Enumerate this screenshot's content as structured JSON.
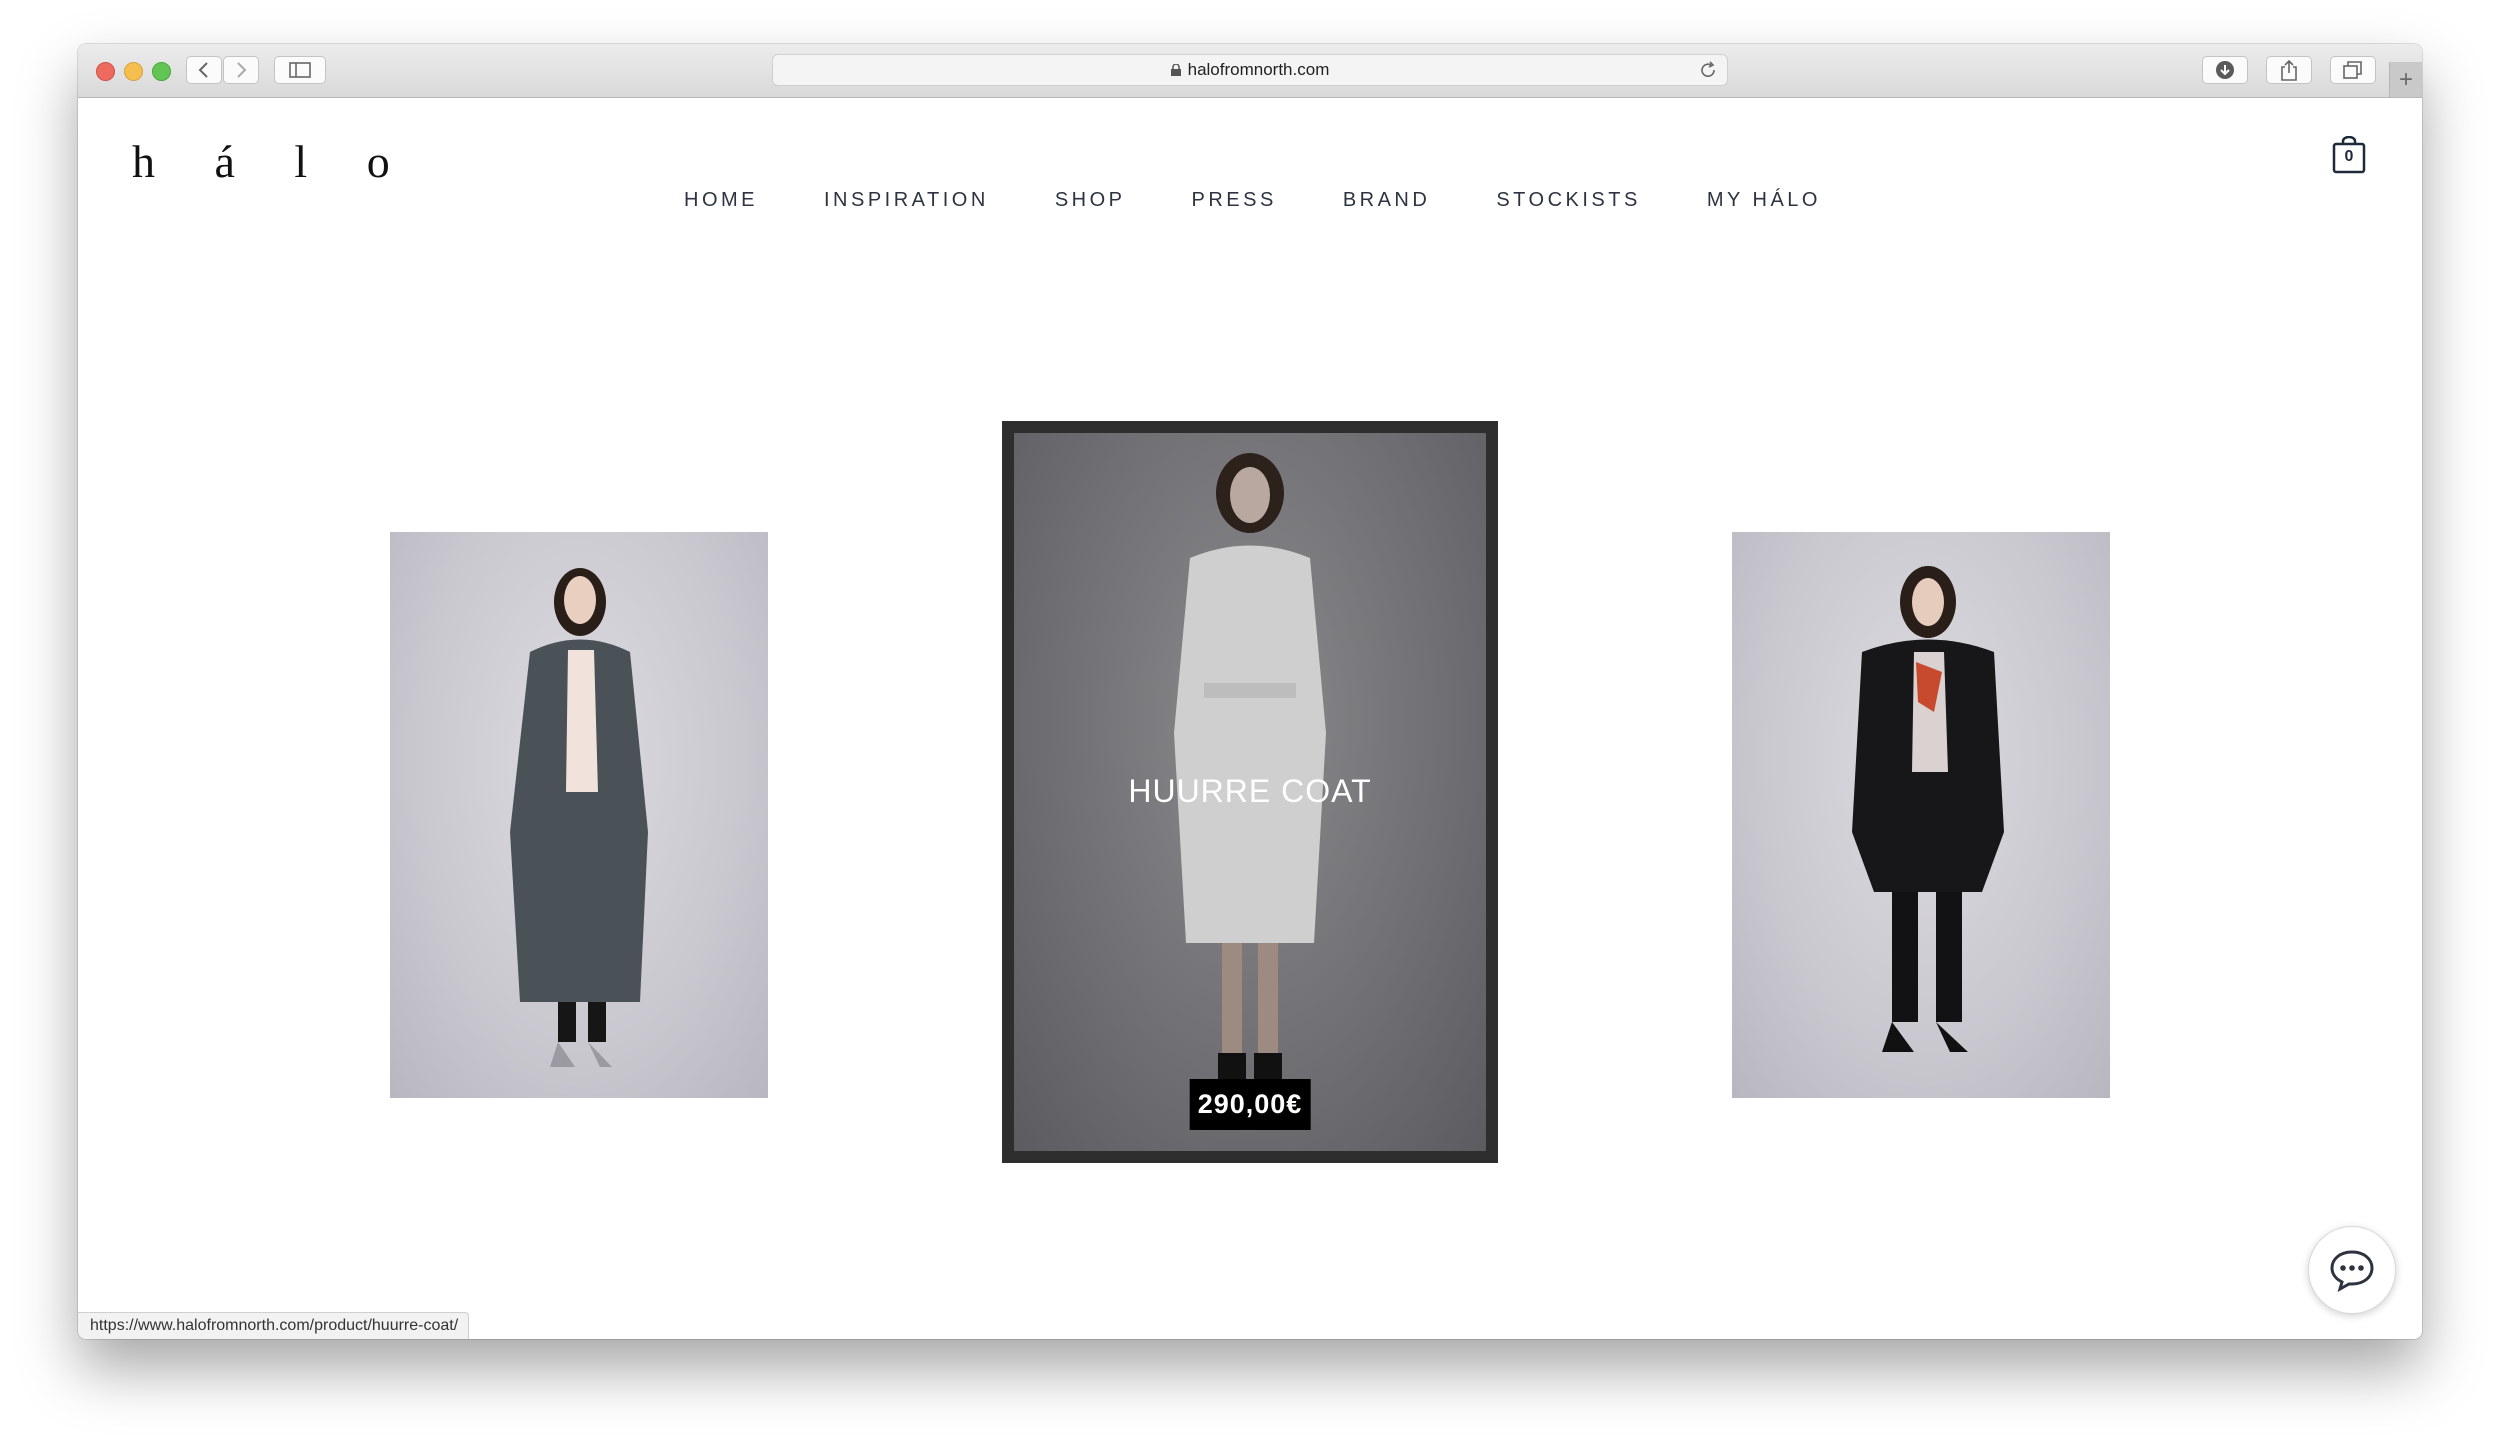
{
  "browser": {
    "url": "halofromnorth.com",
    "status_url": "https://www.halofromnorth.com/product/huurre-coat/"
  },
  "site": {
    "logo": "h á l o",
    "nav": [
      "HOME",
      "INSPIRATION",
      "SHOP",
      "PRESS",
      "BRAND",
      "STOCKISTS",
      "MY HÁLO"
    ],
    "cart_count": "0"
  },
  "featured": {
    "title": "HUURRE COAT",
    "price": "290,00€"
  },
  "icons": [
    "back-icon",
    "forward-icon",
    "sidebar-icon",
    "lock-icon",
    "reload-icon",
    "download-icon",
    "share-icon",
    "tabs-icon",
    "new-tab-icon",
    "cart-icon",
    "chat-icon"
  ]
}
